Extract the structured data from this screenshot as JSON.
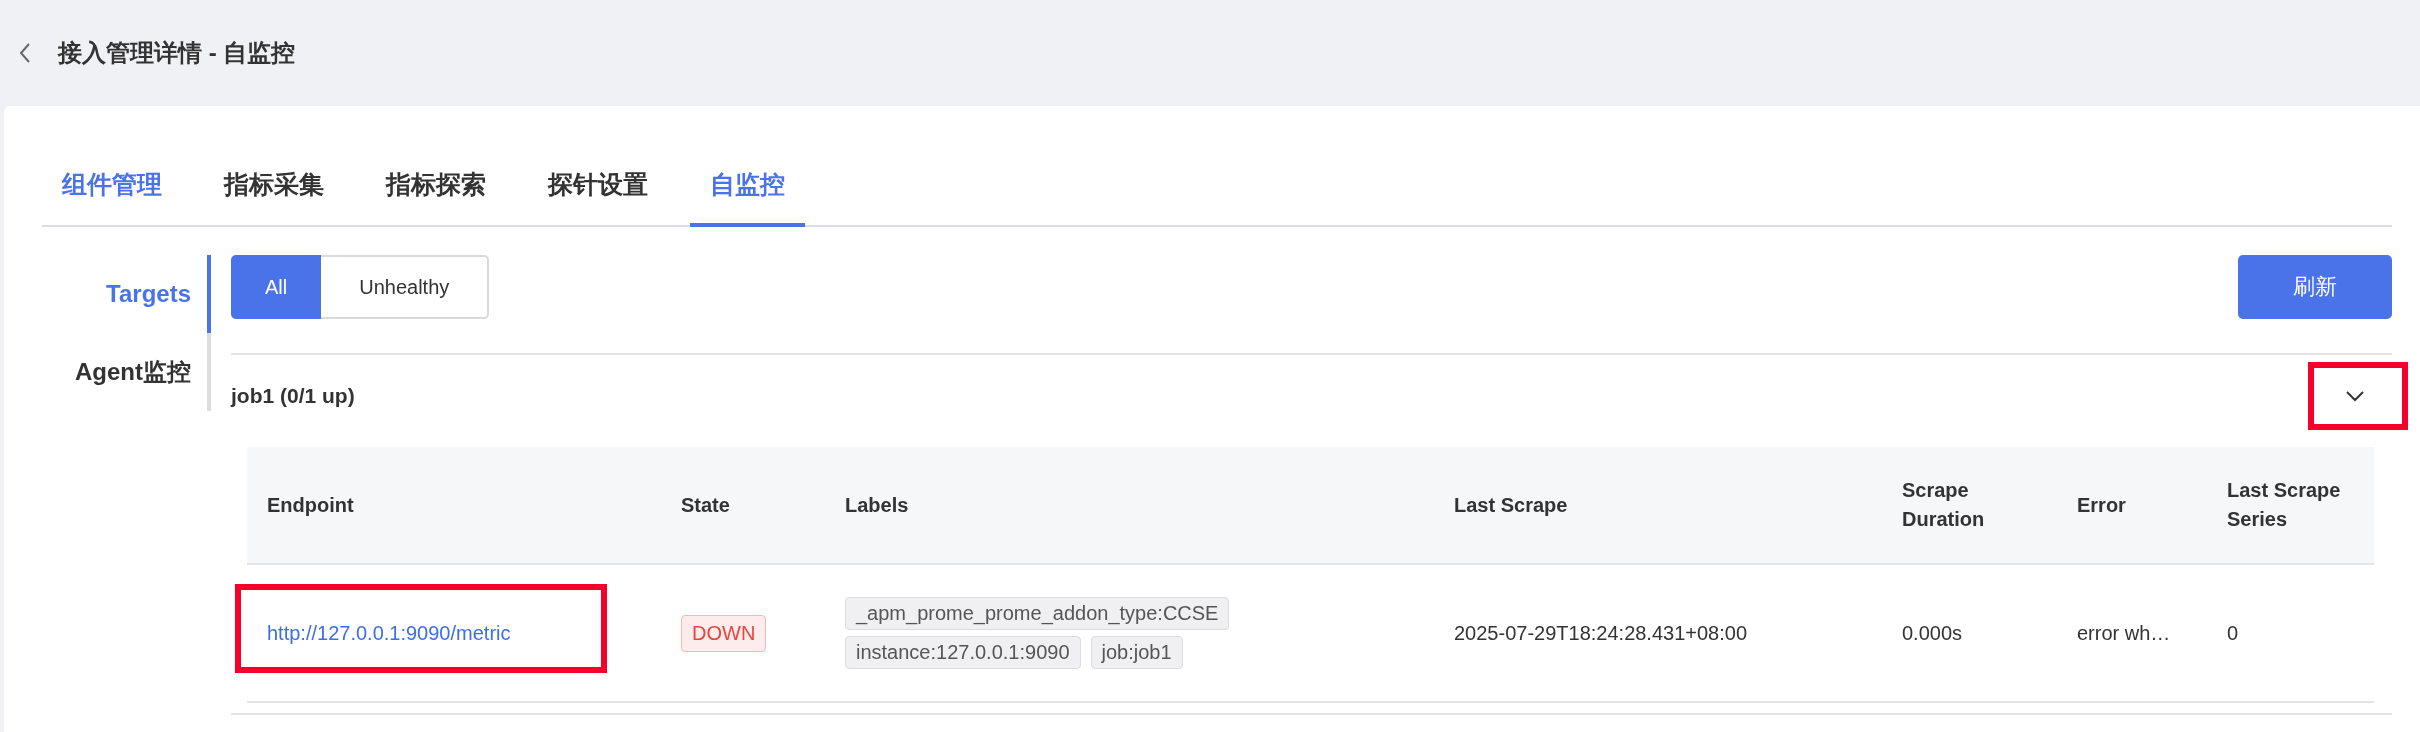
{
  "header": {
    "title": "接入管理详情 - 自监控"
  },
  "tabs": [
    {
      "label": "组件管理",
      "selected": false,
      "hover": true
    },
    {
      "label": "指标采集",
      "selected": false,
      "hover": false
    },
    {
      "label": "指标探索",
      "selected": false,
      "hover": false
    },
    {
      "label": "探针设置",
      "selected": false,
      "hover": false
    },
    {
      "label": "自监控",
      "selected": true,
      "hover": false
    }
  ],
  "sidebar": {
    "items": [
      {
        "label": "Targets",
        "selected": true
      },
      {
        "label": "Agent监控",
        "selected": false
      }
    ]
  },
  "filter": {
    "options": [
      {
        "label": "All",
        "selected": true
      },
      {
        "label": "Unhealthy",
        "selected": false
      }
    ]
  },
  "refresh_button": {
    "label": "刷新"
  },
  "job": {
    "title": "job1 (0/1 up)",
    "expanded": true,
    "toggle_highlighted": true
  },
  "table": {
    "columns": [
      "Endpoint",
      "State",
      "Labels",
      "Last Scrape",
      "Scrape Duration",
      "Error",
      "Last Scrape Series"
    ],
    "rows": [
      {
        "endpoint": "http://127.0.0.1:9090/metric",
        "endpoint_highlighted": true,
        "state": "DOWN",
        "labels": [
          "_apm_prome_prome_addon_type:CCSE",
          "instance:127.0.0.1:9090",
          "job:job1"
        ],
        "last_scrape": "2025-07-29T18:24:28.431+08:00",
        "scrape_duration": "0.000s",
        "error": "error wh…",
        "last_scrape_series": "0"
      }
    ]
  }
}
